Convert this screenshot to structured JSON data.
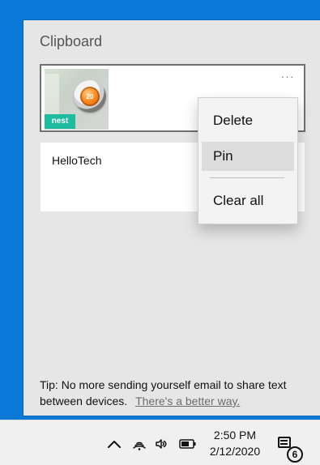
{
  "clipboard": {
    "title": "Clipboard",
    "items": [
      {
        "type": "image",
        "thumbnail": {
          "brand": "nest",
          "display_value": "20"
        },
        "more_button_label": "···"
      },
      {
        "type": "text",
        "text": "HelloTech"
      }
    ],
    "context_menu": {
      "items": [
        "Delete",
        "Pin",
        "Clear all"
      ]
    },
    "tip": {
      "text": "Tip: No more sending yourself email to share text between devices.",
      "link_text": "There's a better way."
    }
  },
  "taskbar": {
    "time": "2:50 PM",
    "date": "2/12/2020",
    "notification_count": "6",
    "icons": [
      "chevron-up-icon",
      "wifi-icon",
      "volume-icon",
      "battery-icon",
      "action-center-icon"
    ]
  },
  "colors": {
    "desktop_blue": "#0a78d7",
    "panel_bg": "#e6e6e6",
    "taskbar_bg": "#f0f0f0",
    "nest_teal": "#1ebc9f",
    "nest_orange": "#ff8a1f"
  }
}
